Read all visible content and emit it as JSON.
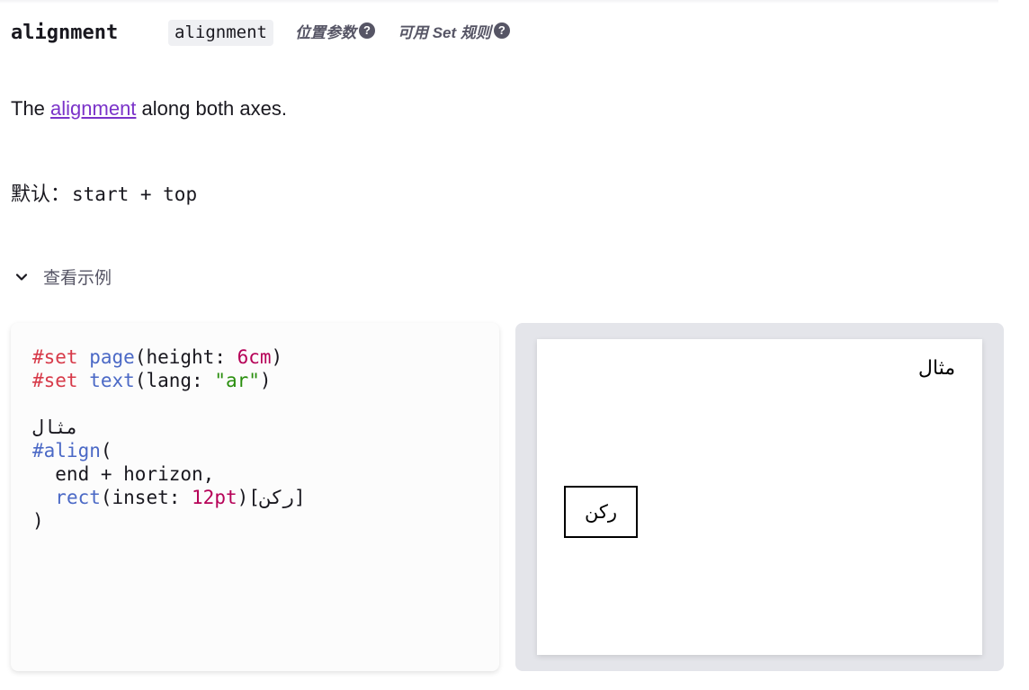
{
  "param": {
    "name": "alignment",
    "type": "alignment",
    "tag_positional": "位置参数",
    "tag_settable": "可用 Set 规则",
    "help_glyph": "?"
  },
  "description": {
    "before": "The ",
    "link": "alignment",
    "after": " along both axes."
  },
  "default": {
    "label": "默认：",
    "value": "start + top"
  },
  "example": {
    "toggle_label": "查看示例",
    "code": {
      "line1_kw": "#set",
      "line1_fn": "page",
      "line1_arg": "(height: ",
      "line1_num": "6cm",
      "line1_end": ")",
      "line2_kw": "#set",
      "line2_fn": "text",
      "line2_arg": "(lang: ",
      "line2_str": "\"ar\"",
      "line2_end": ")",
      "line4_text": "مثال",
      "line5_fn": "#align",
      "line5_end": "(",
      "line6": "  end + horizon,",
      "line7_fn": "rect",
      "line7_arg": "(inset: ",
      "line7_num": "12pt",
      "line7_end": ")[ركن]",
      "line8": ")"
    },
    "preview": {
      "heading_text": "مثال",
      "rect_text": "ركن"
    }
  },
  "colors": {
    "keyword": "#d73a49",
    "function": "#4b69c6",
    "number": "#b60157",
    "string": "#298e0d",
    "link": "#7b33c9"
  }
}
